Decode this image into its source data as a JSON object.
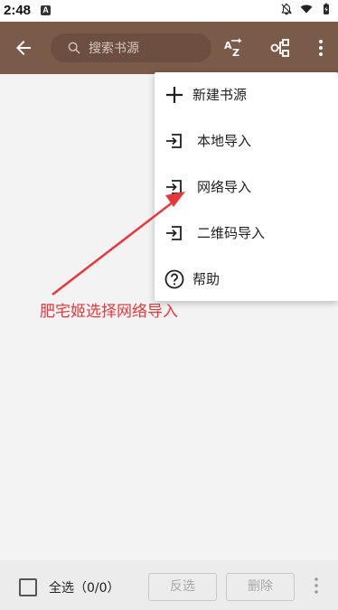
{
  "status_bar": {
    "time": "2:48",
    "app_badge": "A"
  },
  "toolbar": {
    "search_placeholder": "搜索书源"
  },
  "menu": {
    "items": [
      {
        "label": "新建书源",
        "icon": "plus-icon"
      },
      {
        "label": "本地导入",
        "icon": "import-icon"
      },
      {
        "label": "网络导入",
        "icon": "import-icon"
      },
      {
        "label": "二维码导入",
        "icon": "import-icon"
      },
      {
        "label": "帮助",
        "icon": "help-icon"
      }
    ]
  },
  "annotation": {
    "text": "肥宅姬选择网络导入",
    "color": "#e8373b"
  },
  "bottom_bar": {
    "select_all_label": "全选（0/0）",
    "invert_label": "反选",
    "delete_label": "删除"
  },
  "colors": {
    "toolbar": "#7a5a49",
    "search_bg": "#6c4f40",
    "background": "#f3f3f3"
  }
}
